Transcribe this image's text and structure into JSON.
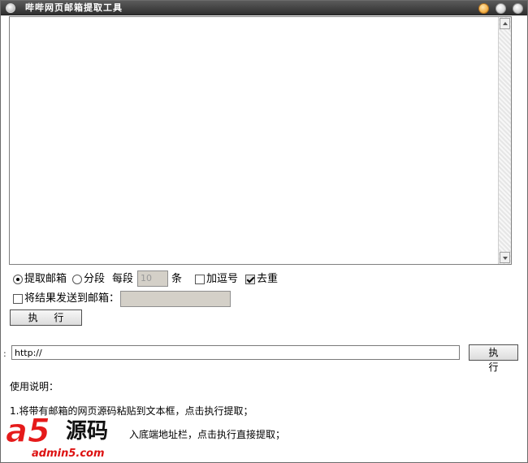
{
  "window": {
    "title": "哔哔网页邮箱提取工具"
  },
  "textarea": {
    "value": ""
  },
  "options": {
    "mode_extract_label": "提取邮箱",
    "mode_segment_label": "分段",
    "per_segment_label": "每段",
    "per_segment_value": "10",
    "unit_label": "条",
    "add_comma_label": "加逗号",
    "add_comma_checked": false,
    "dedupe_label": "去重",
    "dedupe_checked": true,
    "selected_mode": "extract"
  },
  "send": {
    "label": "将结果发送到邮箱：",
    "checked": false,
    "email_value": ""
  },
  "buttons": {
    "execute_label": "执 行",
    "execute_url_label": "执 行"
  },
  "url": {
    "prefix": ":",
    "value": "http://"
  },
  "instructions": {
    "title": "使用说明：",
    "line1": "1.将带有邮箱的网页源码粘贴到文本框，点击执行提取；",
    "line2": "入底端地址栏，点击执行直接提取；"
  },
  "watermark": {
    "brand": "a5",
    "brand_suffix": "源码",
    "url": "admin5.com"
  },
  "colors": {
    "titlebar": "#3f3f3f",
    "watermark_red": "#e51a1a"
  }
}
